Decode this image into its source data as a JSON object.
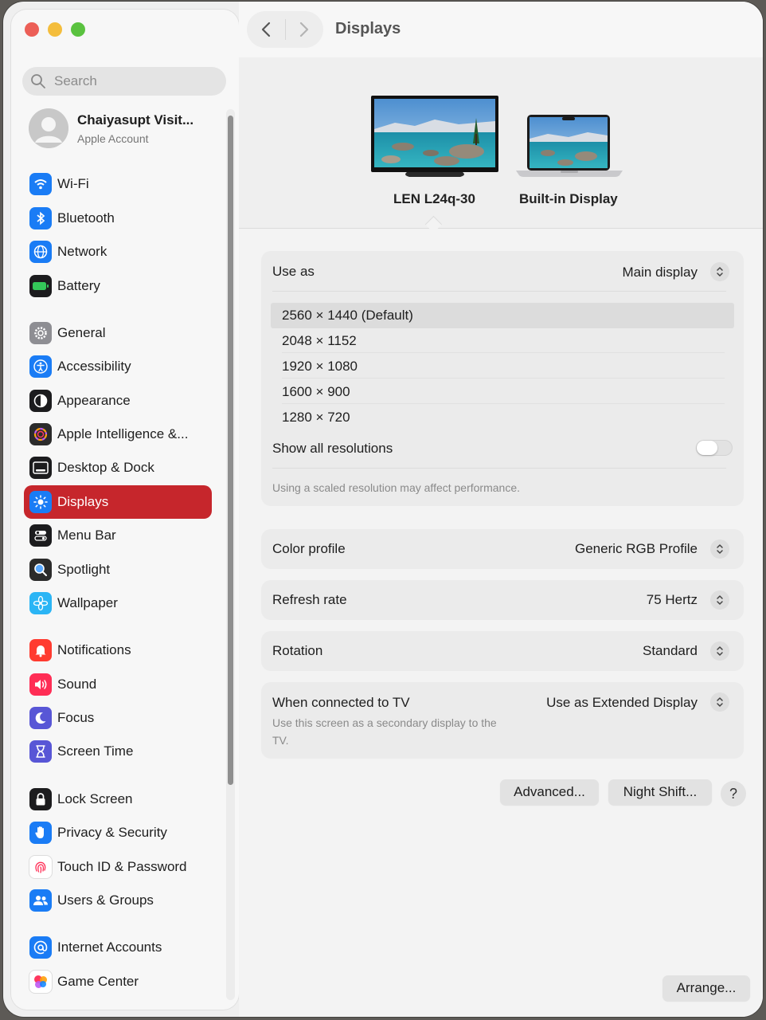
{
  "sidebar": {
    "search": {
      "placeholder": "Search"
    },
    "account": {
      "name": "Chaiyasupt Visit...",
      "subtitle": "Apple Account"
    },
    "items": [
      {
        "label": "Wi-Fi",
        "icon": "wifi-icon",
        "color": "#1a7cf5"
      },
      {
        "label": "Bluetooth",
        "icon": "bluetooth-icon",
        "color": "#1a7cf5"
      },
      {
        "label": "Network",
        "icon": "globe-icon",
        "color": "#1a7cf5"
      },
      {
        "label": "Battery",
        "icon": "battery-icon",
        "color": "#34c759"
      },
      {
        "label": "General",
        "icon": "gear-icon",
        "color": "#8e8e93"
      },
      {
        "label": "Accessibility",
        "icon": "accessibility-icon",
        "color": "#1a7cf5"
      },
      {
        "label": "Appearance",
        "icon": "appearance-icon",
        "color": "#1c1c1e"
      },
      {
        "label": "Apple Intelligence &...",
        "icon": "apple-intelligence-icon",
        "color": "#2b2b2b"
      },
      {
        "label": "Desktop & Dock",
        "icon": "dock-icon",
        "color": "#1c1c1e"
      },
      {
        "label": "Displays",
        "icon": "sun-icon",
        "color": "#1a7cf5"
      },
      {
        "label": "Menu Bar",
        "icon": "menu-bar-icon",
        "color": "#1c1c1e"
      },
      {
        "label": "Spotlight",
        "icon": "spotlight-icon",
        "color": "#2b2b2b"
      },
      {
        "label": "Wallpaper",
        "icon": "flower-icon",
        "color": "#2bb5f5"
      },
      {
        "label": "Notifications",
        "icon": "bell-icon",
        "color": "#ff3b30"
      },
      {
        "label": "Sound",
        "icon": "speaker-icon",
        "color": "#ff2d55"
      },
      {
        "label": "Focus",
        "icon": "moon-icon",
        "color": "#5856d6"
      },
      {
        "label": "Screen Time",
        "icon": "hourglass-icon",
        "color": "#5856d6"
      },
      {
        "label": "Lock Screen",
        "icon": "lock-icon",
        "color": "#1c1c1e"
      },
      {
        "label": "Privacy & Security",
        "icon": "hand-icon",
        "color": "#1a7cf5"
      },
      {
        "label": "Touch ID & Password",
        "icon": "fingerprint-icon",
        "color": "#ff2d55"
      },
      {
        "label": "Users & Groups",
        "icon": "users-icon",
        "color": "#1a7cf5"
      },
      {
        "label": "Internet Accounts",
        "icon": "at-icon",
        "color": "#1a7cf5"
      },
      {
        "label": "Game Center",
        "icon": "game-center-icon",
        "color": "#ffffff"
      }
    ],
    "active": "Displays"
  },
  "toolbar": {
    "title": "Displays"
  },
  "displays": [
    {
      "name": "LEN L24q-30"
    },
    {
      "name": "Built-in Display"
    }
  ],
  "use_as": {
    "label": "Use as",
    "value": "Main display"
  },
  "resolutions": {
    "options": [
      "2560 × 1440 (Default)",
      "2048 × 1152",
      "1920 × 1080",
      "1600 × 900",
      "1280 × 720"
    ],
    "selected": "2560 × 1440 (Default)",
    "show_all_label": "Show all resolutions",
    "show_all_enabled": false,
    "note": "Using a scaled resolution may affect performance."
  },
  "color_profile": {
    "label": "Color profile",
    "value": "Generic RGB Profile"
  },
  "refresh_rate": {
    "label": "Refresh rate",
    "value": "75 Hertz"
  },
  "rotation": {
    "label": "Rotation",
    "value": "Standard"
  },
  "tv": {
    "label": "When connected to TV",
    "value": "Use as Extended Display",
    "description": "Use this screen as a secondary display to the TV."
  },
  "buttons": {
    "advanced": "Advanced...",
    "night_shift": "Night Shift...",
    "help": "?",
    "arrange": "Arrange..."
  },
  "accent_color": "#c6262c"
}
